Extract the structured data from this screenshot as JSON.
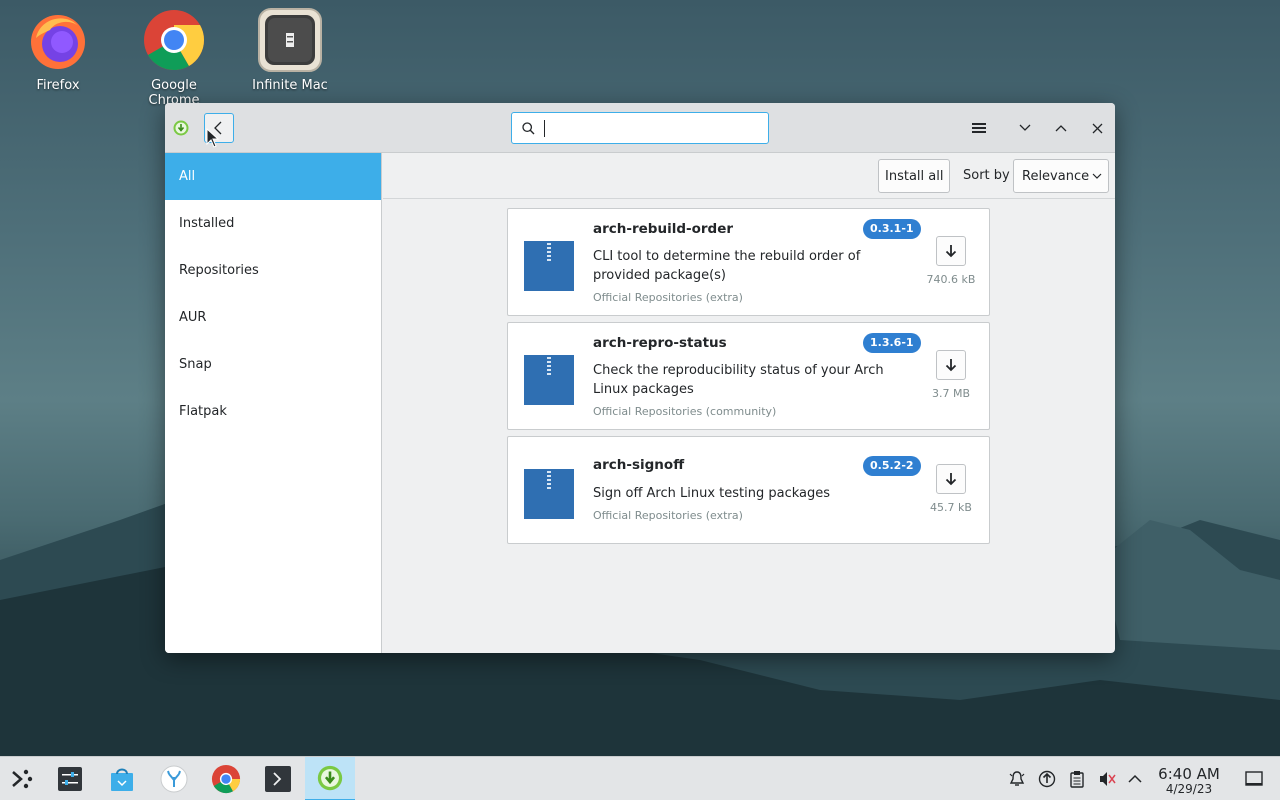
{
  "desktop": {
    "icons": [
      {
        "label": "Firefox"
      },
      {
        "label": "Google Chrome"
      },
      {
        "label": "Infinite Mac"
      }
    ]
  },
  "window": {
    "search": {
      "value": "",
      "placeholder": ""
    },
    "toolbar": {
      "install_all_label": "Install all",
      "sort_label": "Sort by",
      "sort_value": "Relevance"
    },
    "sidebar": {
      "items": [
        {
          "label": "All",
          "active": true
        },
        {
          "label": "Installed"
        },
        {
          "label": "Repositories"
        },
        {
          "label": "AUR"
        },
        {
          "label": "Snap"
        },
        {
          "label": "Flatpak"
        }
      ]
    },
    "packages": [
      {
        "name": "arch-rebuild-order",
        "version": "0.3.1-1",
        "description": "CLI tool to determine the rebuild order of provided package(s)",
        "repo": "Official Repositories (extra)",
        "size": "740.6 kB"
      },
      {
        "name": "arch-repro-status",
        "version": "1.3.6-1",
        "description": "Check the reproducibility status of your Arch Linux packages",
        "repo": "Official Repositories (community)",
        "size": "3.7 MB"
      },
      {
        "name": "arch-signoff",
        "version": "0.5.2-2",
        "description": "Sign off Arch Linux testing packages",
        "repo": "Official Repositories (extra)",
        "size": "45.7 kB"
      }
    ]
  },
  "taskbar": {
    "clock": {
      "time": "6:40 AM",
      "date": "4/29/23"
    }
  },
  "colors": {
    "accent": "#3daee9",
    "badge": "#2f7fd1",
    "package_icon": "#2f6fb2"
  }
}
